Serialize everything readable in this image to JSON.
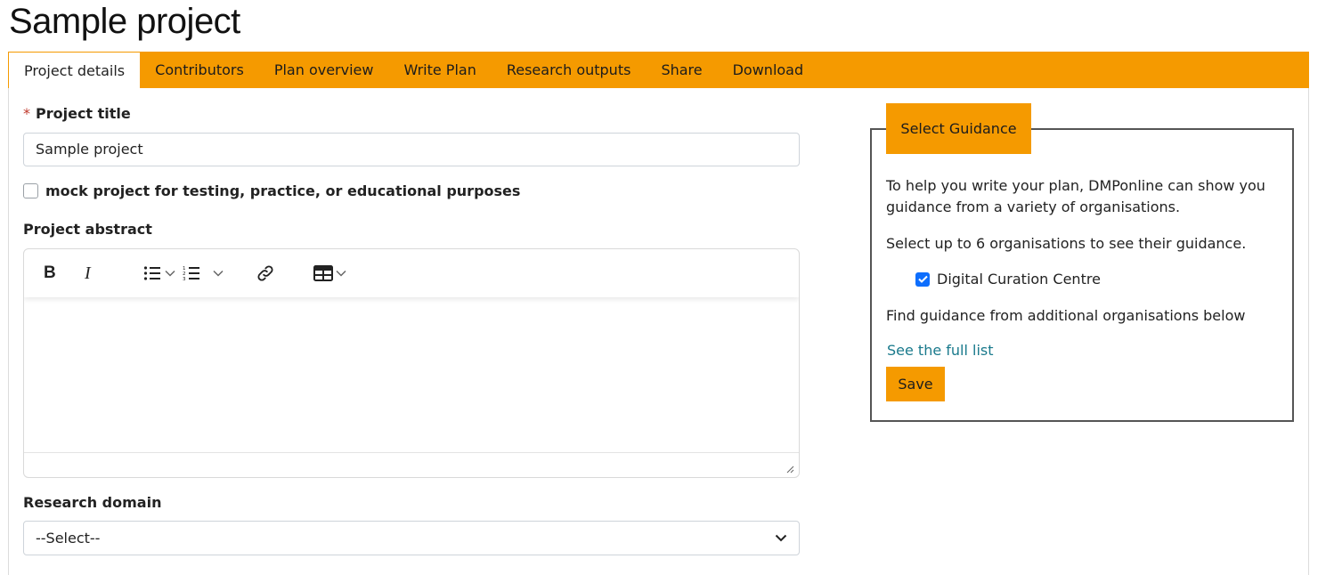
{
  "page_title": "Sample project",
  "tabs": [
    {
      "label": "Project details"
    },
    {
      "label": "Contributors"
    },
    {
      "label": "Plan overview"
    },
    {
      "label": "Write Plan"
    },
    {
      "label": "Research outputs"
    },
    {
      "label": "Share"
    },
    {
      "label": "Download"
    }
  ],
  "form": {
    "required_marker": "*",
    "project_title_label": "Project title",
    "project_title_value": "Sample project",
    "mock_checkbox_label": "mock project for testing, practice, or educational purposes",
    "abstract_label": "Project abstract",
    "research_domain_label": "Research domain",
    "research_domain_value": "--Select--"
  },
  "editor_toolbar": {
    "bold": "B",
    "italic": "I"
  },
  "guidance": {
    "legend": "Select Guidance",
    "intro": "To help you write your plan, DMPonline can show you guidance from a variety of organisations.",
    "select_text": "Select up to 6 organisations to see their guidance.",
    "org_label": "Digital Curation Centre",
    "find_text": "Find guidance from additional organisations below",
    "full_list_link": "See the full list",
    "save_label": "Save"
  },
  "colors": {
    "accent": "#f59a00",
    "link": "#1a7a8c",
    "checkbox_checked": "#0d6efd"
  }
}
